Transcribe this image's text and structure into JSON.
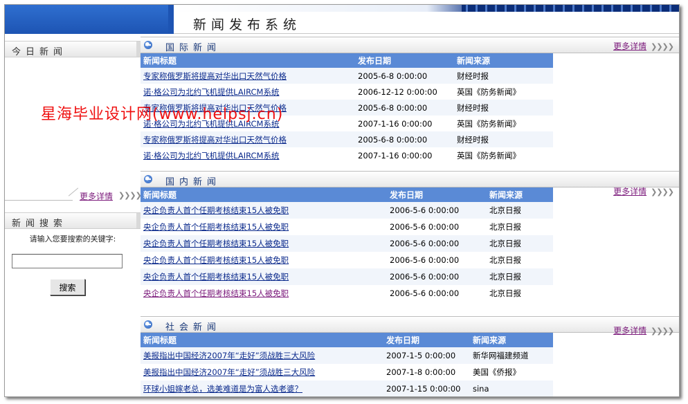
{
  "header": {
    "title": "新闻发布系统"
  },
  "left": {
    "today_title": "今日新闻",
    "more_label": "更多详情",
    "search_title": "新闻搜索",
    "search_prompt": "请输入您要搜索的关键字:",
    "search_value": "",
    "search_button": "搜索"
  },
  "watermark": "星海毕业设计网(www.helpsj.cn)",
  "columns": {
    "title": "新闻标题",
    "date": "发布日期",
    "source": "新闻来源"
  },
  "sections": [
    {
      "title": "国际新闻",
      "more_label": "更多详情",
      "rows": [
        {
          "title": "专家称俄罗斯将提高对华出口天然气价格",
          "date": "2005-6-8 0:00:00",
          "source": "财经时报"
        },
        {
          "title": "诺·格公司为北约飞机提供LAIRCM系统",
          "date": "2006-12-12 0:00:00",
          "source": "英国《防务新闻》"
        },
        {
          "title": "专家称俄罗斯将提高对华出口天然气价格",
          "date": "2005-6-8 0:00:00",
          "source": "财经时报"
        },
        {
          "title": "诺·格公司为北约飞机提供LAIRCM系统",
          "date": "2007-1-16 0:00:00",
          "source": "英国《防务新闻》"
        },
        {
          "title": "专家称俄罗斯将提高对华出口天然气价格",
          "date": "2005-6-8 0:00:00",
          "source": "财经时报"
        },
        {
          "title": "诺·格公司为北约飞机提供LAIRCM系统",
          "date": "2007-1-16 0:00:00",
          "source": "英国《防务新闻》"
        }
      ]
    },
    {
      "title": "国内新闻",
      "more_label": "更多详情",
      "rows": [
        {
          "title": "央企负责人首个任期考核结束15人被免职",
          "date": "2006-5-6 0:00:00",
          "source": "北京日报"
        },
        {
          "title": "央企负责人首个任期考核结束15人被免职",
          "date": "2006-5-6 0:00:00",
          "source": "北京日报"
        },
        {
          "title": "央企负责人首个任期考核结束15人被免职",
          "date": "2006-5-6 0:00:00",
          "source": "北京日报"
        },
        {
          "title": "央企负责人首个任期考核结束15人被免职",
          "date": "2006-5-6 0:00:00",
          "source": "北京日报"
        },
        {
          "title": "央企负责人首个任期考核结束15人被免职",
          "date": "2006-5-6 0:00:00",
          "source": "北京日报"
        },
        {
          "title": "央企负责人首个任期考核结束15人被免职",
          "date": "2006-5-6 0:00:00",
          "source": "北京日报"
        }
      ]
    },
    {
      "title": "社会新闻",
      "more_label": "更多详情",
      "rows": [
        {
          "title": "美报指出中国经济2007年“走好”须战胜三大风险",
          "date": "2007-1-5 0:00:00",
          "source": "新华网福建频道"
        },
        {
          "title": "美报指出中国经济2007年“走好”须战胜三大风险",
          "date": "2007-1-8 0:00:00",
          "source": "美国《侨报》"
        },
        {
          "title": "环球小姐嫁老总，选美难道是为富人选老婆？",
          "date": "2007-1-15 0:00:00",
          "source": "sina"
        }
      ]
    }
  ]
}
